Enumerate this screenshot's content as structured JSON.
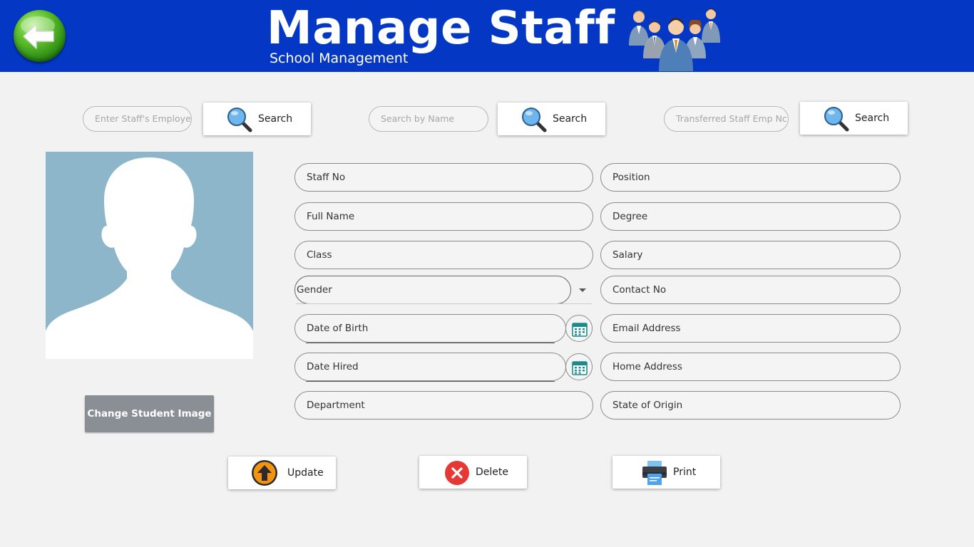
{
  "header": {
    "title": "Manage Staff",
    "subtitle": "School Management",
    "bg_color": "#0438c4",
    "back_icon": "back-arrow-icon",
    "staff_icon": "staff-group-icon"
  },
  "search": [
    {
      "placeholder": "Enter Staff's Employe",
      "button_label": "Search",
      "icon": "search-icon"
    },
    {
      "placeholder": "Search by Name",
      "button_label": "Search",
      "icon": "search-icon"
    },
    {
      "placeholder": "Transferred Staff Emp Nc",
      "button_label": "Search",
      "icon": "search-icon"
    }
  ],
  "photo": {
    "icon": "user-silhouette-icon"
  },
  "change_image_label": "Change Student Image",
  "fields": {
    "staff_no": "Staff No",
    "position": "Position",
    "full_name": "Full Name",
    "degree": "Degree",
    "class": "Class",
    "salary": "Salary",
    "gender": "Gender",
    "contact_no": "Contact No",
    "date_of_birth": "Date of Birth",
    "email_address": "Email Address",
    "date_hired": "Date Hired",
    "home_address": "Home Address",
    "department": "Department",
    "state_of_origin": "State of Origin"
  },
  "actions": {
    "update": {
      "label": "Update",
      "icon": "upload-icon",
      "color": "#f29411"
    },
    "delete": {
      "label": "Delete",
      "icon": "close-icon",
      "color": "#e53935"
    },
    "print": {
      "label": "Print",
      "icon": "printer-icon",
      "color": "#4fa3e8"
    }
  }
}
